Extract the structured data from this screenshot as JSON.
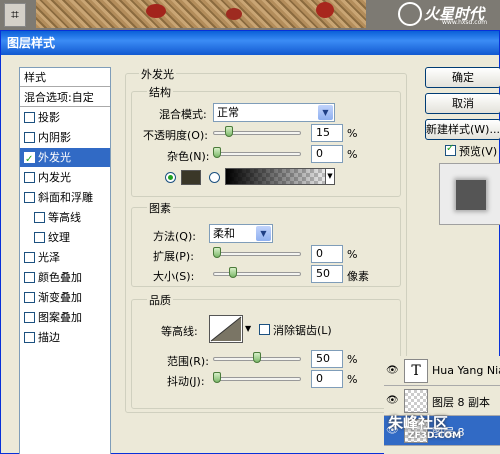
{
  "brand": {
    "logo_text": "火星时代",
    "logo_url": "www.hxsd.com"
  },
  "dialog": {
    "title": "图层样式",
    "left_list": {
      "header": "样式",
      "blend_options": "混合选项:自定",
      "items": [
        {
          "label": "投影",
          "checked": false
        },
        {
          "label": "内阴影",
          "checked": false
        },
        {
          "label": "外发光",
          "checked": true,
          "selected": true
        },
        {
          "label": "内发光",
          "checked": false
        },
        {
          "label": "斜面和浮雕",
          "checked": false
        },
        {
          "label": "等高线",
          "checked": false,
          "indent": true
        },
        {
          "label": "纹理",
          "checked": false,
          "indent": true
        },
        {
          "label": "光泽",
          "checked": false
        },
        {
          "label": "颜色叠加",
          "checked": false
        },
        {
          "label": "渐变叠加",
          "checked": false
        },
        {
          "label": "图案叠加",
          "checked": false
        },
        {
          "label": "描边",
          "checked": false
        }
      ]
    },
    "section_title": "外发光",
    "structure": {
      "title": "结构",
      "blend_mode_label": "混合模式:",
      "blend_mode_value": "正常",
      "opacity_label": "不透明度(O):",
      "opacity_value": "15",
      "opacity_fraction": 0.15,
      "noise_label": "杂色(N):",
      "noise_value": "0",
      "noise_fraction": 0,
      "percent": "%",
      "color": "#3a3728"
    },
    "elements": {
      "title": "图素",
      "method_label": "方法(Q):",
      "method_value": "柔和",
      "spread_label": "扩展(P):",
      "spread_value": "0",
      "spread_fraction": 0,
      "size_label": "大小(S):",
      "size_value": "50",
      "size_fraction": 0.2,
      "percent": "%",
      "px_unit": "像素"
    },
    "quality": {
      "title": "品质",
      "contour_label": "等高线:",
      "antialias_label": "消除锯齿(L)",
      "antialias_checked": false,
      "range_label": "范围(R):",
      "range_value": "50",
      "range_fraction": 0.5,
      "jitter_label": "抖动(J):",
      "jitter_value": "0",
      "jitter_fraction": 0,
      "percent": "%"
    },
    "buttons": {
      "ok": "确定",
      "cancel": "取消",
      "new_style": "新建样式(W)...",
      "preview_label": "预览(V)",
      "preview_checked": true
    }
  },
  "layers": [
    {
      "name": "Hua Yang Nia",
      "thumb": "T"
    },
    {
      "name": "图层 8 副本",
      "thumb": ""
    },
    {
      "name": "图层 8",
      "thumb": ""
    }
  ],
  "watermark": {
    "text": "朱峰社区",
    "sub": "ZF3D.COM"
  }
}
